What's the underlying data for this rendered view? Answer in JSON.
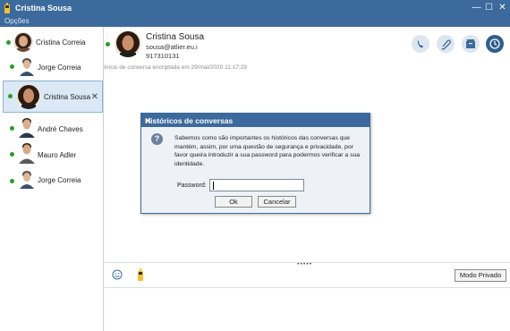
{
  "window": {
    "title": "Cristina Sousa"
  },
  "menu": {
    "options_label": "Opções"
  },
  "contacts": [
    {
      "name": "Cristina Correia",
      "status": "online"
    },
    {
      "name": "Jorge Correia",
      "status": "online"
    },
    {
      "name": "Cristina Sousa",
      "status": "online",
      "active": true
    },
    {
      "name": "André Chaves",
      "status": "online"
    },
    {
      "name": "Mauro Adler",
      "status": "online"
    },
    {
      "name": "Jorge Correia",
      "status": "online"
    }
  ],
  "chat_header": {
    "name": "Cristina Sousa",
    "email": "sousa@atlier.eu.i",
    "phone": "917310131",
    "actions": [
      "phone-icon",
      "attach-icon",
      "archive-icon",
      "history-icon"
    ]
  },
  "notice": "Início de conversa encriptada em 29/mai/2020 11:17:29",
  "compose": {
    "grip": "•••••",
    "private_mode_label": "Modo Privado",
    "icons": [
      "smiley-icon",
      "mobile-icon"
    ]
  },
  "dialog": {
    "title": "Históricos de conversas",
    "message": "Sabemos como são importantes os históricos das conversas que mantém, assim, por uma questão de segurança e privacidade, por favor queira introduzir a sua password para podermos verificar a sua identidade.",
    "password_label": "Password:",
    "password_value": "",
    "ok_label": "Ok",
    "cancel_label": "Cancelar"
  },
  "colors": {
    "titlebar": "#3c6a9c",
    "online": "#2c9b2c",
    "selected": "#dbe9f6"
  }
}
